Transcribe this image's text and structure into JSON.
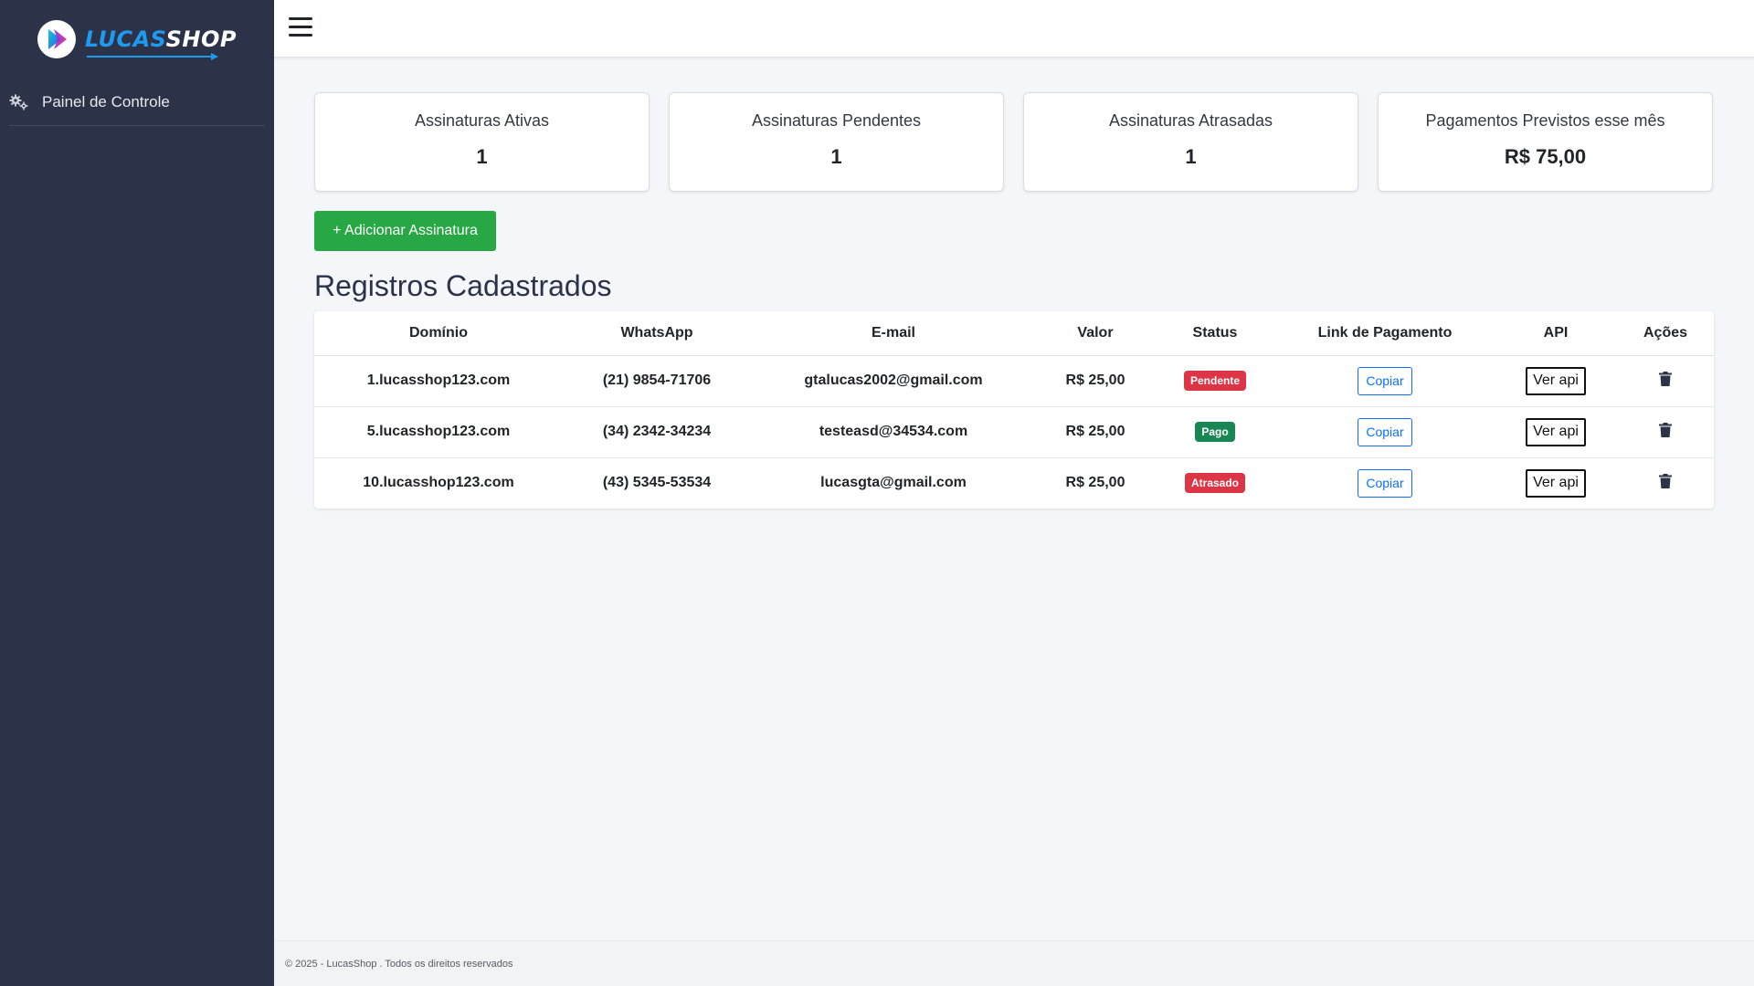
{
  "brand": {
    "part1": "LUCAS",
    "part2": "SHOP",
    "logo_icon": "lucasshop-logo-icon"
  },
  "sidebar": {
    "items": [
      {
        "label": "Painel de Controle",
        "icon": "gears-icon"
      }
    ]
  },
  "topbar": {
    "menu_icon": "hamburger-icon"
  },
  "cards": [
    {
      "title": "Assinaturas Ativas",
      "value": "1"
    },
    {
      "title": "Assinaturas Pendentes",
      "value": "1"
    },
    {
      "title": "Assinaturas Atrasadas",
      "value": "1"
    },
    {
      "title": "Pagamentos Previstos esse mês",
      "value": "R$ 75,00"
    }
  ],
  "actions": {
    "add_label": "+ Adicionar Assinatura"
  },
  "section": {
    "title": "Registros Cadastrados"
  },
  "table": {
    "headers": [
      "Domínio",
      "WhatsApp",
      "E-mail",
      "Valor",
      "Status",
      "Link de Pagamento",
      "API",
      "Ações"
    ],
    "copy_label": "Copiar",
    "api_label": "Ver api",
    "delete_icon": "trash-icon",
    "rows": [
      {
        "domain": "1.lucasshop123.com",
        "whatsapp": "(21) 9854-71706",
        "email": "gtalucas2002@gmail.com",
        "value": "R$ 25,00",
        "status": "Pendente",
        "status_color": "#dc3545"
      },
      {
        "domain": "5.lucasshop123.com",
        "whatsapp": "(34) 2342-34234",
        "email": "testeasd@34534.com",
        "value": "R$ 25,00",
        "status": "Pago",
        "status_color": "#198754"
      },
      {
        "domain": "10.lucasshop123.com",
        "whatsapp": "(43) 5345-53534",
        "email": "lucasgta@gmail.com",
        "value": "R$ 25,00",
        "status": "Atrasado",
        "status_color": "#dc3545"
      }
    ]
  },
  "footer": {
    "text": "© 2025 - LucasShop . Todos os direitos reservados"
  },
  "colors": {
    "sidebar": "#2c3349",
    "primary_green": "#28a745",
    "link_blue": "#0d6efd",
    "danger": "#dc3545",
    "success": "#198754"
  }
}
